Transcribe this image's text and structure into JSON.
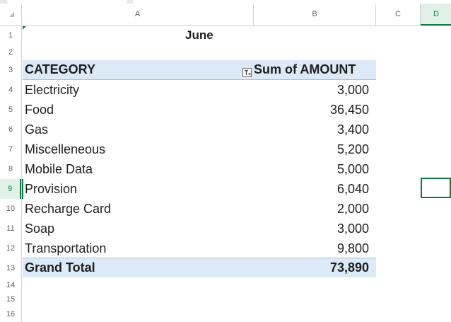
{
  "columns": [
    "A",
    "B",
    "C",
    "D"
  ],
  "rows": [
    "1",
    "2",
    "3",
    "4",
    "5",
    "6",
    "7",
    "8",
    "9",
    "10",
    "11",
    "12",
    "13",
    "14",
    "15",
    "16"
  ],
  "pivot": {
    "title": "June",
    "header_category": "CATEGORY",
    "header_sum": "Sum of AMOUNT",
    "items": [
      {
        "category": "Electricity",
        "amount": "3,000"
      },
      {
        "category": "Food",
        "amount": "36,450"
      },
      {
        "category": "Gas",
        "amount": "3,400"
      },
      {
        "category": "Miscelleneous",
        "amount": "5,200"
      },
      {
        "category": "Mobile Data",
        "amount": "5,000"
      },
      {
        "category": "Provision",
        "amount": "6,040"
      },
      {
        "category": "Recharge Card",
        "amount": "2,000"
      },
      {
        "category": "Soap",
        "amount": "3,000"
      },
      {
        "category": "Transportation",
        "amount": "9,800"
      }
    ],
    "grand_total_label": "Grand Total",
    "grand_total_value": "73,890"
  },
  "selection": {
    "column": "D",
    "row": "9"
  },
  "colors": {
    "pivot_band": "#dce9f6",
    "selection_accent": "#107c41"
  },
  "icons": {
    "filter_button": "filter-dropdown-icon",
    "select_all": "select-all-triangle-icon"
  }
}
